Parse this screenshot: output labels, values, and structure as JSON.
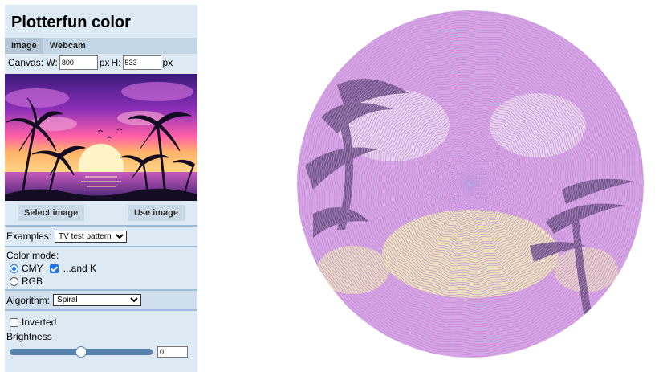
{
  "app": {
    "title": "Plotterfun color"
  },
  "tabs": [
    {
      "label": "Image",
      "active": true
    },
    {
      "label": "Webcam",
      "active": false
    }
  ],
  "canvas": {
    "label": "Canvas: W:",
    "width": "800",
    "width_unit": "px",
    "height_label": "H:",
    "height": "533",
    "height_unit": "px"
  },
  "buttons": {
    "select": "Select image",
    "use": "Use image"
  },
  "examples": {
    "label": "Examples:",
    "selected": "TV test pattern"
  },
  "color_mode": {
    "label": "Color mode:",
    "options": [
      {
        "label": "CMY",
        "checked": true
      },
      {
        "label": "RGB",
        "checked": false
      }
    ],
    "and_k_label": "...and K",
    "and_k_checked": true
  },
  "algorithm": {
    "label": "Algorithm:",
    "selected": "Spiral"
  },
  "inverted": {
    "label": "Inverted",
    "checked": false
  },
  "brightness": {
    "label": "Brightness",
    "value": "0",
    "slider_fraction": 0.5
  },
  "colors": {
    "sidebar_bg": "#dde9f3",
    "accent": "#1a73e8",
    "separator": "#9fbcd6",
    "plot_magenta": "#c77fd8",
    "plot_dark": "#5d4670",
    "plot_yellow": "#f2efb0",
    "plot_cyan": "#9fd0e6"
  }
}
